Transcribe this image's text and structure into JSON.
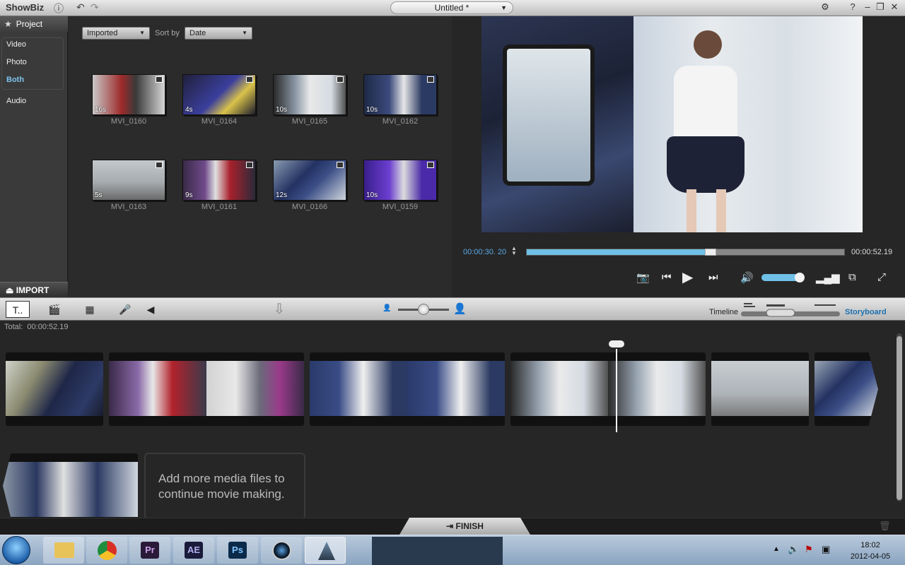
{
  "titlebar": {
    "app_name": "ShowBiz",
    "project_name": "Untitled *",
    "help": "?"
  },
  "sidebar": {
    "header": "Project",
    "items": [
      {
        "label": "Video"
      },
      {
        "label": "Photo"
      },
      {
        "label": "Both"
      },
      {
        "label": "Audio"
      }
    ],
    "active": "Both",
    "import_label": "IMPORT"
  },
  "library": {
    "filter_value": "Imported",
    "sort_label": "Sort by",
    "sort_value": "Date",
    "clips": [
      {
        "name": "MVI_0160",
        "duration": "16s"
      },
      {
        "name": "MVI_0164",
        "duration": "4s"
      },
      {
        "name": "MVI_0165",
        "duration": "10s"
      },
      {
        "name": "MVI_0162",
        "duration": "10s"
      },
      {
        "name": "MVI_0163",
        "duration": "5s"
      },
      {
        "name": "MVI_0161",
        "duration": "9s"
      },
      {
        "name": "MVI_0166",
        "duration": "12s"
      },
      {
        "name": "MVI_0159",
        "duration": "10s"
      }
    ]
  },
  "preview": {
    "current_time": "00:00:30. 20",
    "total_time": "00:00:52.19",
    "progress": 0.58,
    "volume": 0.85
  },
  "toolbar": {
    "timeline_label": "Timeline",
    "storyboard_label": "Storyboard"
  },
  "storyboard": {
    "total_label": "Total:",
    "total_value": "00:00:52.19",
    "add_more_line1": "Add more media files to",
    "add_more_line2": "continue movie making."
  },
  "finish": {
    "label": "FINISH"
  },
  "taskbar": {
    "apps": [
      {
        "label": "Pr"
      },
      {
        "label": "AE"
      },
      {
        "label": "Ps"
      }
    ],
    "time": "18:02",
    "date": "2012-04-05"
  },
  "colors": {
    "accent_blue": "#6fc0e6",
    "active_text": "#7cc3ee",
    "storyboard_blue": "#1d6fae"
  }
}
